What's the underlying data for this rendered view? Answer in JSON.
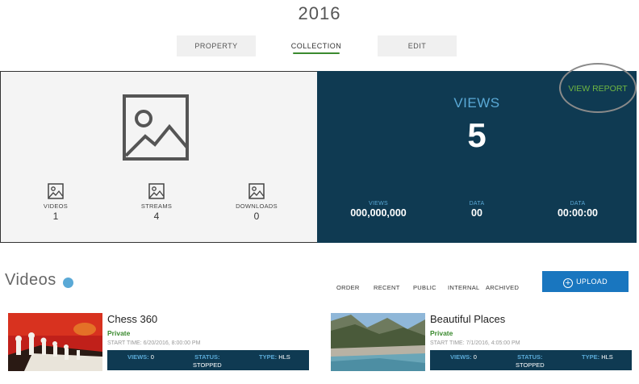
{
  "page": {
    "title": "2016"
  },
  "tabs": [
    {
      "label": "PROPERTY"
    },
    {
      "label": "COLLECTION"
    },
    {
      "label": "EDIT"
    }
  ],
  "collection": {
    "stats": [
      {
        "label": "VIDEOS",
        "value": "1"
      },
      {
        "label": "STREAMS",
        "value": "4"
      },
      {
        "label": "DOWNLOADS",
        "value": "0"
      }
    ]
  },
  "views_panel": {
    "label": "VIEWS",
    "value": "5",
    "view_report": "VIEW REPORT",
    "stats": [
      {
        "label": "VIEWS",
        "value": "000,000,000"
      },
      {
        "label": "DATA",
        "value": "00"
      },
      {
        "label": "DATA",
        "value": "00:00:00"
      }
    ]
  },
  "videos": {
    "title": "Videos",
    "filters": [
      "ORDER",
      "RECENT",
      "PUBLIC",
      "INTERNAL",
      "ARCHIVED"
    ],
    "upload_label": "UPLOAD",
    "items": [
      {
        "title": "Chess 360",
        "privacy": "Private",
        "start_time": "START TIME: 6/20/2016, 8:00:00 PM",
        "views_key": "VIEWS:",
        "views": "0",
        "status_key": "STATUS:",
        "status": "STOPPED",
        "type_key": "TYPE:",
        "type": "HLS"
      },
      {
        "title": "Beautiful Places",
        "privacy": "Private",
        "start_time": "START TIME: 7/1/2016, 4:05:00 PM",
        "views_key": "VIEWS:",
        "views": "0",
        "status_key": "STATUS:",
        "status": "STOPPED",
        "type_key": "TYPE:",
        "type": "HLS"
      }
    ]
  },
  "colors": {
    "panel": "#0f3a52",
    "accent_blue": "#5aa9d6",
    "accent_green": "#3b8a2f",
    "button_blue": "#1976bf"
  }
}
